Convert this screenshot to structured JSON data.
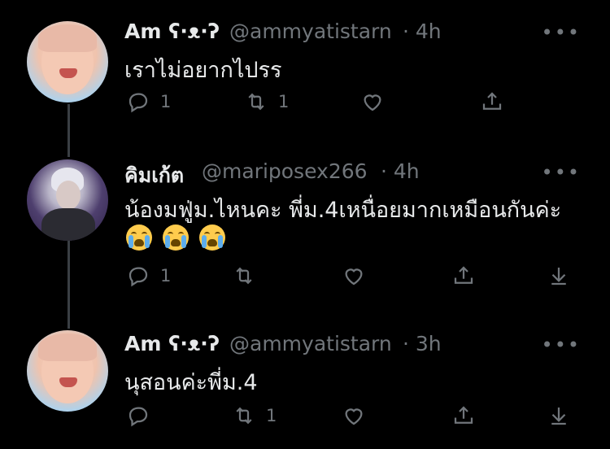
{
  "tweets": [
    {
      "display_name": "Am ʕ·ᴥ·ʔ",
      "handle": "@ammyatistarn",
      "time": "· 4h",
      "text": "เราไม่อยากไปรร",
      "reply_count": "1",
      "retweet_count": "1",
      "like_count": ""
    },
    {
      "display_name": "คิมเก้ต",
      "handle": "@mariposex266",
      "time": "· 4h",
      "text": "น้องมฟู่ม.ไหนคะ พี่ม.4เหนื่อยมากเหมือนกันค่ะ",
      "emojis": [
        "loudly-crying-face",
        "loudly-crying-face",
        "loudly-crying-face"
      ],
      "reply_count": "1",
      "retweet_count": "",
      "like_count": ""
    },
    {
      "display_name": "Am ʕ·ᴥ·ʔ",
      "handle": "@ammyatistarn",
      "time": "· 3h",
      "text": "นุสอนค่ะพี่ม.4",
      "reply_count": "",
      "retweet_count": "1",
      "like_count": ""
    }
  ],
  "more_label": "•••",
  "colors": {
    "background": "#000000",
    "text": "#e7e9ea",
    "muted": "#71767b",
    "thread_line": "#3a3f44"
  }
}
